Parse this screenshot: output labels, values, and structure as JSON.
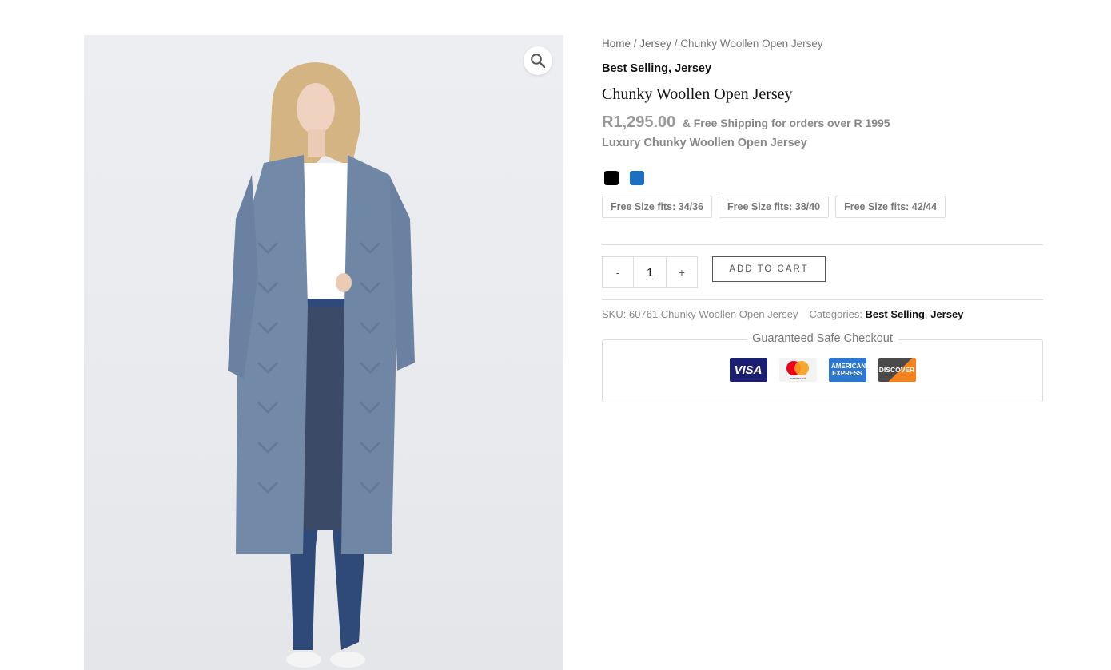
{
  "breadcrumb": {
    "home": "Home",
    "sep1": " / ",
    "category": "Jersey",
    "sep2": " / ",
    "current": "Chunky Woollen Open Jersey"
  },
  "categories_top": {
    "first": "Best Selling",
    "comma": ", ",
    "second": "Jersey"
  },
  "product": {
    "title": "Chunky Woollen Open Jersey",
    "price": "R1,295.00",
    "shipping_note": "& Free Shipping for orders over R 1995",
    "short_description": "Luxury Chunky Woollen Open Jersey",
    "colors": [
      {
        "name": "black",
        "hex": "#000000"
      },
      {
        "name": "blue",
        "hex": "#1e6fc0"
      }
    ],
    "sizes": [
      "Free Size fits: 34/36",
      "Free Size fits: 38/40",
      "Free Size fits: 42/44"
    ],
    "quantity": {
      "minus": "-",
      "value": "1",
      "plus": "+"
    },
    "add_to_cart": "ADD TO CART"
  },
  "meta": {
    "sku_text": "SKU: 60761 Chunky Woollen Open Jersey",
    "categories_label": "Categories: ",
    "category_1": "Best Selling",
    "comma": ", ",
    "category_2": "Jersey"
  },
  "checkout": {
    "legend": "Guaranteed Safe Checkout",
    "cards": [
      {
        "label": "VISA",
        "icon": "visa-icon"
      },
      {
        "label": "mastercard",
        "icon": "mastercard-icon"
      },
      {
        "label": "AMERICAN EXPRESS",
        "icon": "amex-icon"
      },
      {
        "label": "DISCOVER",
        "icon": "discover-icon"
      }
    ]
  },
  "gallery": {
    "zoom_icon": "magnifier-icon"
  }
}
